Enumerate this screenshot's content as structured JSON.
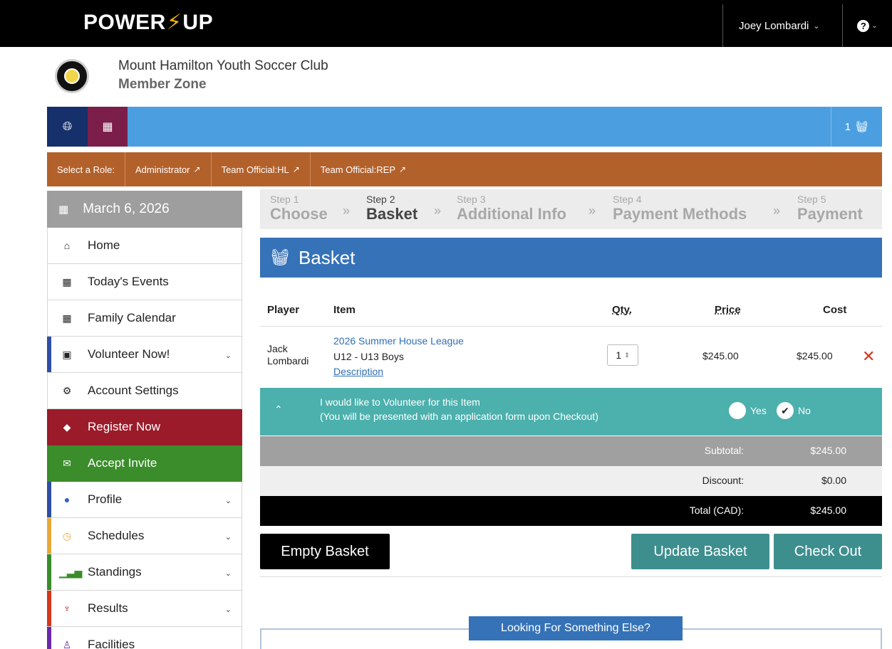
{
  "topbar": {
    "logo_left": "POWER",
    "logo_right": "UP",
    "user_name": "Joey Lombardi"
  },
  "club": {
    "name": "Mount Hamilton Youth Soccer Club",
    "zone": "Member Zone"
  },
  "nav": {
    "basket_count": "1"
  },
  "roles": {
    "label": "Select a Role:",
    "items": [
      "Administrator",
      "Team Official:HL",
      "Team Official:REP"
    ]
  },
  "sidebar": {
    "date": "March 6, 2026",
    "items": [
      {
        "label": "Home"
      },
      {
        "label": "Today's Events"
      },
      {
        "label": "Family Calendar"
      },
      {
        "label": "Volunteer Now!"
      },
      {
        "label": "Account Settings"
      },
      {
        "label": "Register Now"
      },
      {
        "label": "Accept Invite"
      },
      {
        "label": "Profile"
      },
      {
        "label": "Schedules"
      },
      {
        "label": "Standings"
      },
      {
        "label": "Results"
      },
      {
        "label": "Facilities"
      }
    ]
  },
  "steps": [
    {
      "num": "Step 1",
      "title": "Choose"
    },
    {
      "num": "Step 2",
      "title": "Basket"
    },
    {
      "num": "Step 3",
      "title": "Additional Info"
    },
    {
      "num": "Step 4",
      "title": "Payment Methods"
    },
    {
      "num": "Step 5",
      "title": "Payment"
    }
  ],
  "basket": {
    "title": "Basket",
    "columns": {
      "player": "Player",
      "item": "Item",
      "qty": "Qty.",
      "price": "Price",
      "cost": "Cost"
    },
    "row": {
      "player_first": "Jack",
      "player_last": "Lombardi",
      "item_name": "2026 Summer House League",
      "item_division": "U12 - U13 Boys",
      "description_link": "Description",
      "qty": "1",
      "price": "$245.00",
      "cost": "$245.00"
    },
    "volunteer": {
      "line1": "I would like to Volunteer for this Item",
      "line2": "(You will be presented with an application form upon Checkout)",
      "yes": "Yes",
      "no": "No"
    },
    "totals": {
      "subtotal_label": "Subtotal:",
      "subtotal": "$245.00",
      "discount_label": "Discount:",
      "discount": "$0.00",
      "total_label": "Total (CAD):",
      "total": "$245.00"
    },
    "buttons": {
      "empty": "Empty Basket",
      "update": "Update Basket",
      "checkout": "Check Out"
    }
  },
  "looking": {
    "title": "Looking For Something Else?"
  },
  "colors": {
    "topbar": "#000000",
    "bluebar": "#4b9fe0",
    "rolebar": "#b3612b",
    "basket_header": "#3572b7",
    "volunteer": "#4cb0ad",
    "teal_button": "#3d8f8e",
    "register": "#9b1b2a",
    "accept": "#3a8d2a",
    "remove": "#d4371c"
  }
}
